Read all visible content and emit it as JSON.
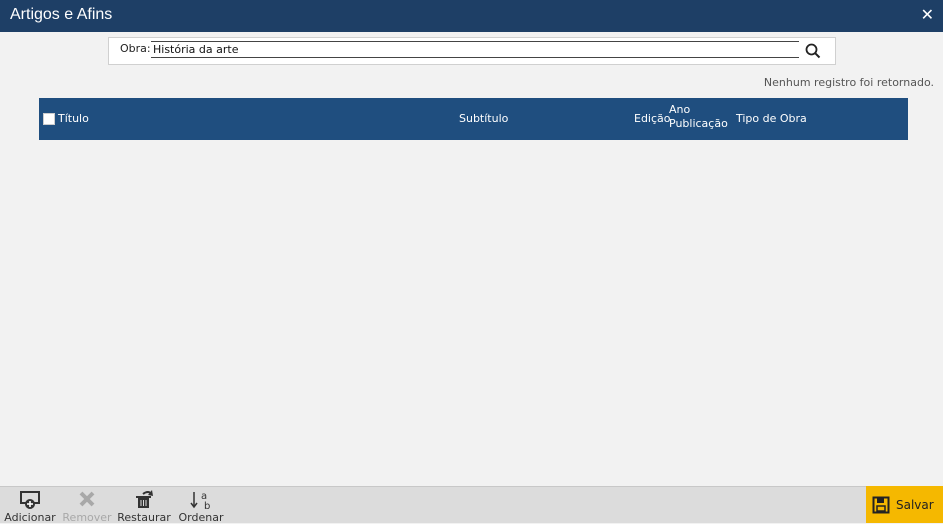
{
  "window": {
    "title": "Artigos e Afins"
  },
  "search": {
    "label": "Obra:",
    "value": "História da arte"
  },
  "status": "Nenhum registro foi retornado.",
  "table": {
    "columns": {
      "titulo": "Título",
      "subtitulo": "Subtítulo",
      "edicao": "Edição",
      "ano_line1": "Ano",
      "ano_line2": "Publicação",
      "tipo": "Tipo de Obra"
    }
  },
  "toolbar": {
    "adicionar": "Adicionar",
    "remover": "Remover",
    "restaurar": "Restaurar",
    "ordenar": "Ordenar",
    "ordenar_icon_a": "a",
    "ordenar_icon_b": "b",
    "salvar": "Salvar"
  },
  "colors": {
    "titlebar": "#1e3f66",
    "table_header": "#1f4e7f",
    "save_button": "#f5b800",
    "background": "#f2f2f2"
  }
}
